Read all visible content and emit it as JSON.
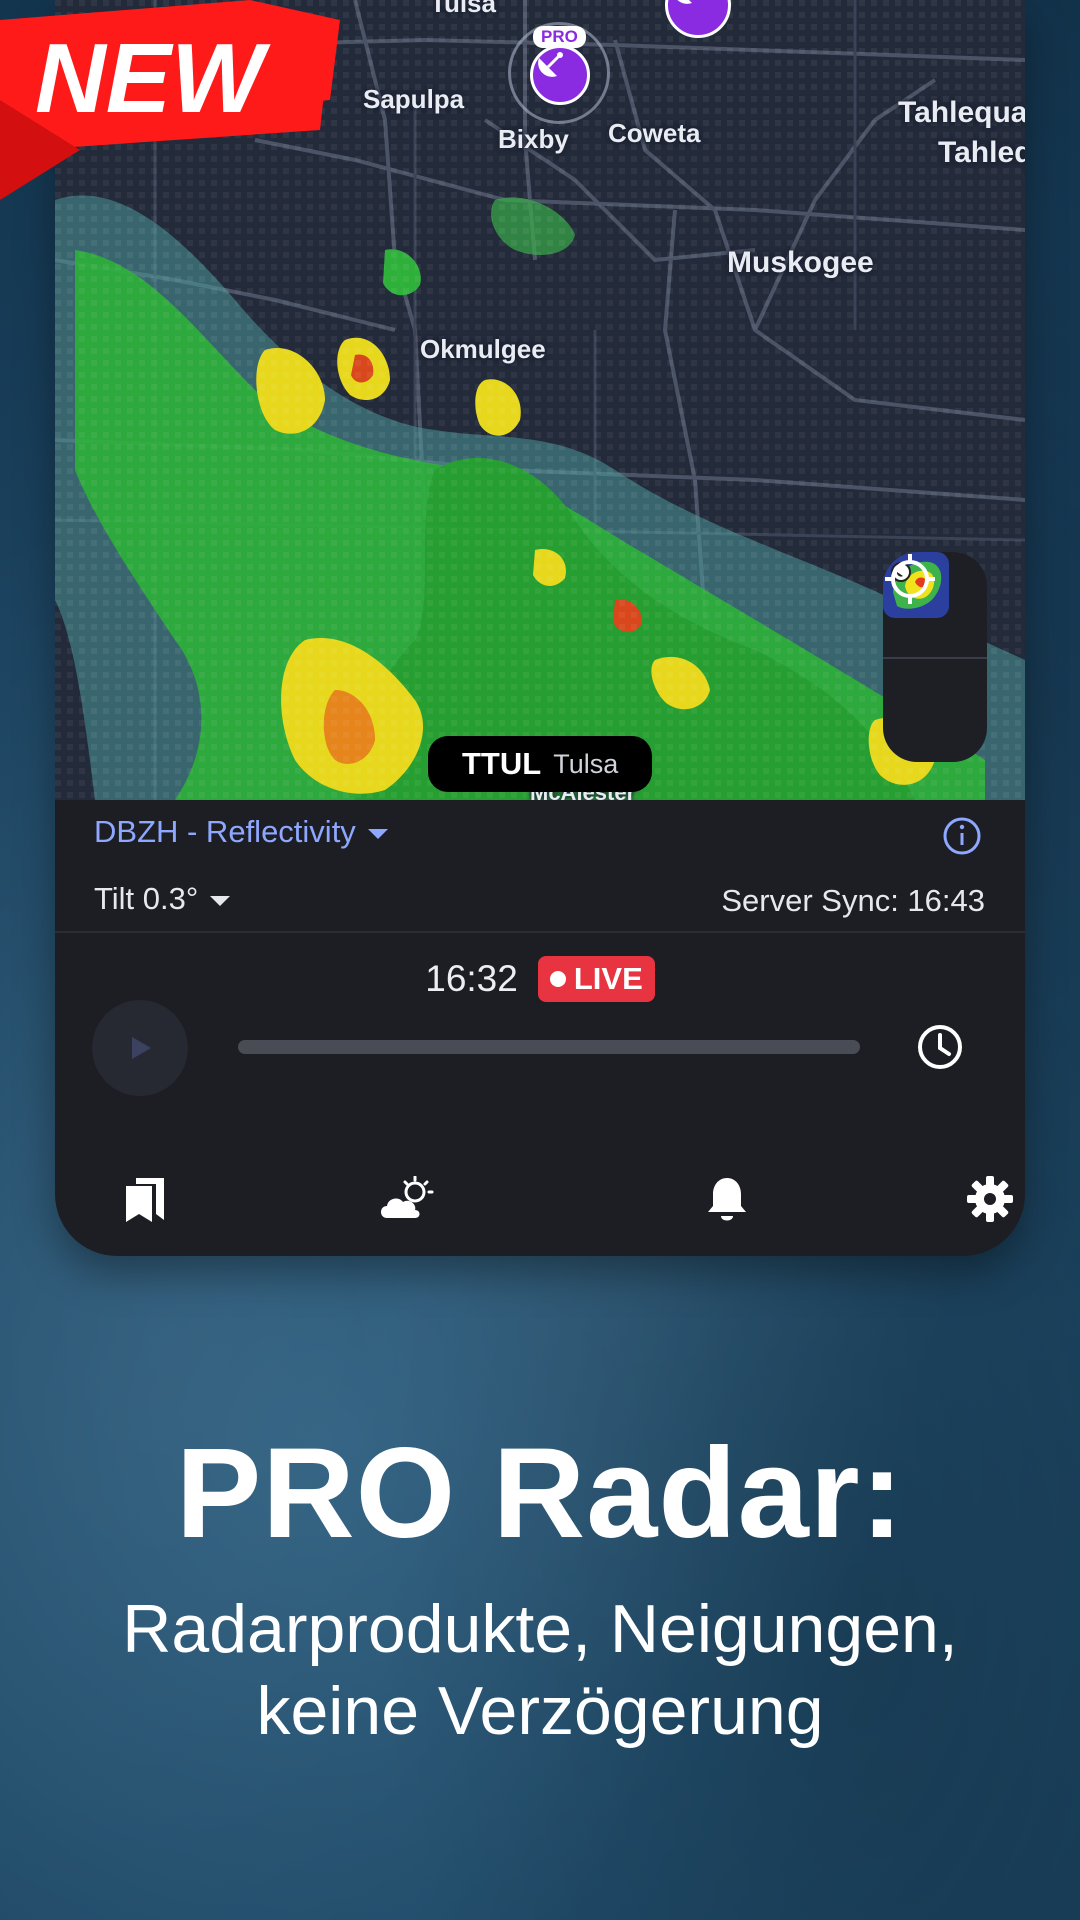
{
  "badge": {
    "text": "NEW"
  },
  "map": {
    "cities": [
      {
        "name": "Tulsa"
      },
      {
        "name": "Sapulpa"
      },
      {
        "name": "Bixby"
      },
      {
        "name": "Coweta"
      },
      {
        "name": "Tahlequa"
      },
      {
        "name": "Tahleq"
      },
      {
        "name": "Muskogee"
      },
      {
        "name": "Okmulgee"
      },
      {
        "name": "McAlester"
      }
    ],
    "pro_tag": "PRO",
    "station": {
      "code": "TTUL",
      "name": "Tulsa"
    }
  },
  "controls": {
    "product": "DBZH - Reflectivity",
    "tilt": "Tilt 0.3°",
    "server_sync": "Server Sync: 16:43",
    "time": "16:32",
    "live_label": "LIVE"
  },
  "promo": {
    "headline": "PRO Radar:",
    "subline_1": "Radarprodukte, Neigungen,",
    "subline_2": "keine Verzögerung"
  },
  "colors": {
    "accent_blue": "#8fa8ff",
    "live_red": "#e83341",
    "badge_red": "#ff1a1a",
    "pin_purple": "#8a2be2",
    "panel_bg": "#1d1e24"
  },
  "icons": {
    "bookmark": "bookmarks-icon",
    "weather": "partly-cloudy-icon",
    "alerts": "bell-icon",
    "settings": "gear-icon",
    "locate": "crosshair-icon",
    "layers": "radar-layers-icon",
    "info": "info-icon",
    "play": "play-icon",
    "history": "clock-icon"
  }
}
